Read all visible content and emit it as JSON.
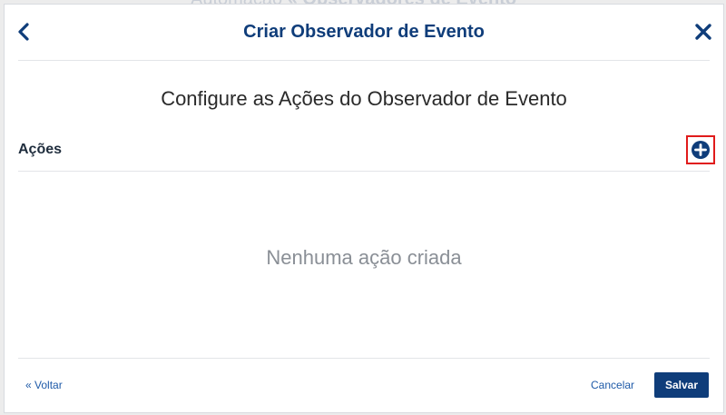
{
  "background": {
    "title_prefix": "Automação",
    "title_sep": " « ",
    "title_main": "Observadores de Evento"
  },
  "modal": {
    "title": "Criar Observador de Evento",
    "subtitle": "Configure as Ações do Observador de Evento",
    "section_label": "Ações",
    "empty_message": "Nenhuma ação criada",
    "back_label": "« Voltar",
    "cancel_label": "Cancelar",
    "save_label": "Salvar",
    "icons": {
      "back": "chevron-left-icon",
      "close": "close-icon",
      "add": "plus-circle-icon"
    }
  },
  "colors": {
    "primary": "#0f3d7a",
    "link": "#1e5aa8",
    "highlight": "#e01b1b",
    "muted": "#8a8f96"
  }
}
